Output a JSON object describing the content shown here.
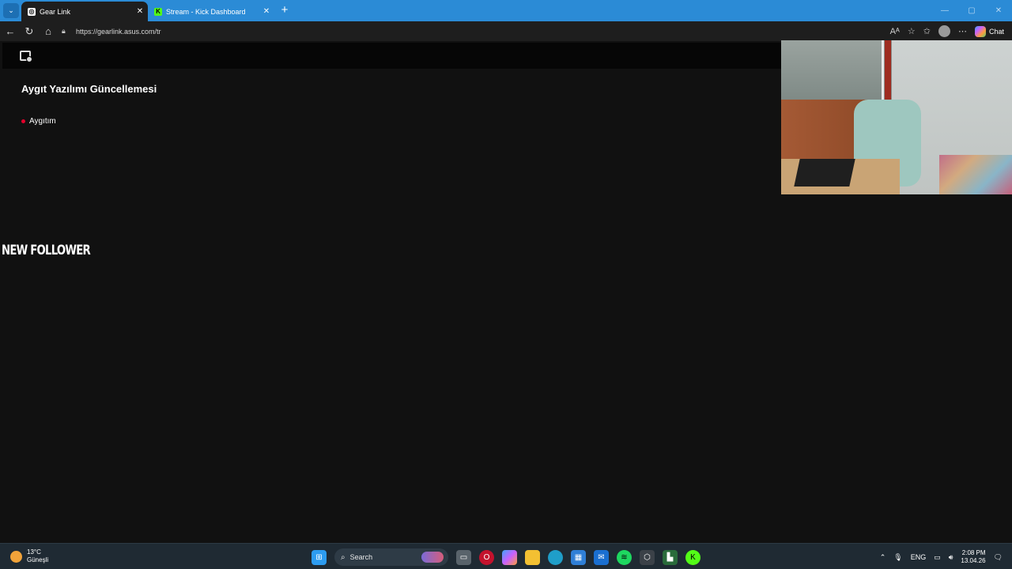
{
  "browser": {
    "tabs": [
      {
        "title": "Gear Link",
        "active": true,
        "favicon": "gear-link-icon"
      },
      {
        "title": "Stream - Kick Dashboard",
        "active": false,
        "favicon": "kick-icon"
      }
    ],
    "url": "https://gearlink.asus.com/tr",
    "chat_label": "Chat"
  },
  "page": {
    "title": "Aygıt Yazılımı Güncellemesi",
    "device_item": "Aygıtım",
    "overlay_text": "NEW FOLLOWER",
    "accent_color": "#e4002b"
  },
  "taskbar": {
    "weather": {
      "temp": "13°C",
      "condition": "Güneşli"
    },
    "search_label": "Search",
    "language": "ENG",
    "time": "2:08 PM",
    "date": "13.04.26"
  }
}
